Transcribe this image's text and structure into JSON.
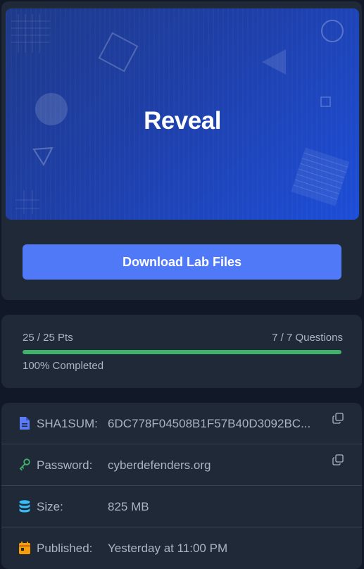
{
  "banner": {
    "title": "Reveal"
  },
  "actions": {
    "download_label": "Download Lab Files"
  },
  "progress": {
    "points": "25 / 25 Pts",
    "questions": "7 / 7 Questions",
    "completed": "100% Completed",
    "fraction": 1.0
  },
  "info": {
    "sha1": {
      "label": "SHA1SUM:",
      "value": "6DC778F04508B1F57B40D3092BC..."
    },
    "password": {
      "label": "Password:",
      "value": "cyberdefenders.org"
    },
    "size": {
      "label": "Size:",
      "value": "825 MB"
    },
    "published": {
      "label": "Published:",
      "value": "Yesterday at 11:00 PM"
    }
  },
  "colors": {
    "accent": "#4f79f7",
    "progress": "#3fb36a",
    "file_icon": "#5b7cf6",
    "key_icon": "#3fb36a",
    "db_icon": "#38bdf8",
    "calendar_icon": "#f59e0b"
  }
}
